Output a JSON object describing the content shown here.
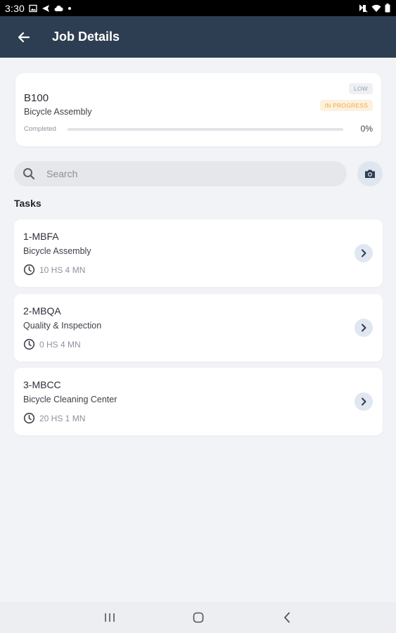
{
  "status_bar": {
    "time": "3:30",
    "icons_left": [
      "image-icon",
      "send-icon",
      "cloud-icon",
      "dot-icon"
    ],
    "icons_right": [
      "no-signal-icon",
      "wifi-icon",
      "battery-icon"
    ]
  },
  "app_bar": {
    "title": "Job Details",
    "back_icon": "arrow-left-icon"
  },
  "job": {
    "code": "B100",
    "name": "Bicycle Assembly",
    "priority": "LOW",
    "status": "IN PROGRESS",
    "completed_label": "Completed",
    "progress_percent": 0,
    "progress_text": "0%",
    "status_color": "#f0a94a"
  },
  "search": {
    "placeholder": "Search",
    "value": ""
  },
  "tasks_heading": "Tasks",
  "tasks": [
    {
      "code": "1-MBFA",
      "name": "Bicycle Assembly",
      "time": "10 HS 4 MN"
    },
    {
      "code": "2-MBQA",
      "name": "Quality & Inspection",
      "time": "0 HS 4 MN"
    },
    {
      "code": "3-MBCC",
      "name": "Bicycle Cleaning Center",
      "time": "20 HS 1 MN"
    }
  ],
  "nav_bar": {
    "icons": [
      "recent-apps-icon",
      "home-icon",
      "back-icon"
    ]
  },
  "colors": {
    "app_bar": "#2e3e52",
    "background": "#f2f3f6",
    "accent_light": "#e0e7f1"
  }
}
